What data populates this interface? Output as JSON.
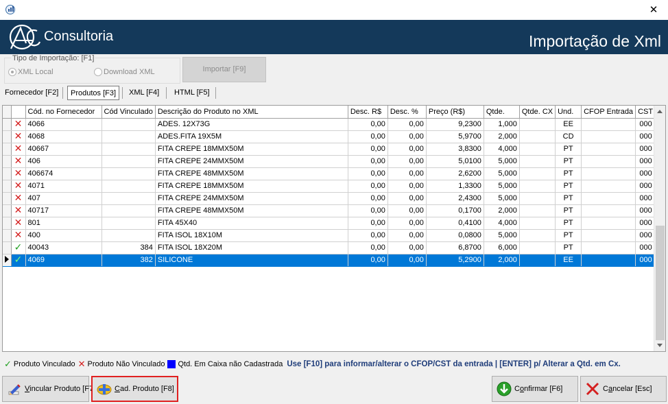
{
  "window": {
    "close_glyph": "✕"
  },
  "banner": {
    "brand": "Consultoria",
    "title": "Importação de Xml",
    "logo_letters": "AC"
  },
  "import_type": {
    "label": "Tipo de Importação: [F1]",
    "options": [
      {
        "label": "XML Local",
        "selected": true
      },
      {
        "label": "Download XML",
        "selected": false
      }
    ],
    "import_button": "Importar [F9]"
  },
  "tabs": [
    {
      "label": "Fornecedor [F2]",
      "active": false
    },
    {
      "label": "Produtos [F3]",
      "active": true
    },
    {
      "label": "XML [F4]",
      "active": false
    },
    {
      "label": "HTML [F5]",
      "active": false
    }
  ],
  "grid": {
    "columns": [
      "Cód. no Fornecedor",
      "Cód Vinculado",
      "Descrição do Produto no XML",
      "Desc. R$",
      "Desc. %",
      "Preço (R$)",
      "Qtde.",
      "Qtde. CX",
      "Und.",
      "CFOP Entrada",
      "CST"
    ],
    "rows": [
      {
        "status": "x",
        "cod": "4066",
        "vinc": "",
        "desc": "ADES. 12X73G",
        "desc_rs": "0,00",
        "desc_pct": "0,00",
        "preco": "9,2300",
        "qtde": "1,000",
        "qtde_cx": "",
        "und": "EE",
        "cfop": "",
        "cst": "000"
      },
      {
        "status": "x",
        "cod": "4068",
        "vinc": "",
        "desc": "ADES.FITA 19X5M",
        "desc_rs": "0,00",
        "desc_pct": "0,00",
        "preco": "5,9700",
        "qtde": "2,000",
        "qtde_cx": "",
        "und": "CD",
        "cfop": "",
        "cst": "000"
      },
      {
        "status": "x",
        "cod": "40667",
        "vinc": "",
        "desc": "FITA CREPE 18MMX50M",
        "desc_rs": "0,00",
        "desc_pct": "0,00",
        "preco": "3,8300",
        "qtde": "4,000",
        "qtde_cx": "",
        "und": "PT",
        "cfop": "",
        "cst": "000"
      },
      {
        "status": "x",
        "cod": "406",
        "vinc": "",
        "desc": "FITA CREPE 24MMX50M",
        "desc_rs": "0,00",
        "desc_pct": "0,00",
        "preco": "5,0100",
        "qtde": "5,000",
        "qtde_cx": "",
        "und": "PT",
        "cfop": "",
        "cst": "000"
      },
      {
        "status": "x",
        "cod": "406674",
        "vinc": "",
        "desc": "FITA CREPE 48MMX50M",
        "desc_rs": "0,00",
        "desc_pct": "0,00",
        "preco": "2,6200",
        "qtde": "5,000",
        "qtde_cx": "",
        "und": "PT",
        "cfop": "",
        "cst": "000"
      },
      {
        "status": "x",
        "cod": "4071",
        "vinc": "",
        "desc": "FITA CREPE 18MMX50M",
        "desc_rs": "0,00",
        "desc_pct": "0,00",
        "preco": "1,3300",
        "qtde": "5,000",
        "qtde_cx": "",
        "und": "PT",
        "cfop": "",
        "cst": "000"
      },
      {
        "status": "x",
        "cod": "407",
        "vinc": "",
        "desc": "FITA CREPE 24MMX50M",
        "desc_rs": "0,00",
        "desc_pct": "0,00",
        "preco": "2,4300",
        "qtde": "5,000",
        "qtde_cx": "",
        "und": "PT",
        "cfop": "",
        "cst": "000"
      },
      {
        "status": "x",
        "cod": "40717",
        "vinc": "",
        "desc": "FITA CREPE 48MMX50M",
        "desc_rs": "0,00",
        "desc_pct": "0,00",
        "preco": "0,1700",
        "qtde": "2,000",
        "qtde_cx": "",
        "und": "PT",
        "cfop": "",
        "cst": "000"
      },
      {
        "status": "x",
        "cod": "801",
        "vinc": "",
        "desc": "FITA 45X40",
        "desc_rs": "0,00",
        "desc_pct": "0,00",
        "preco": "0,4100",
        "qtde": "4,000",
        "qtde_cx": "",
        "und": "PT",
        "cfop": "",
        "cst": "000"
      },
      {
        "status": "x",
        "cod": "400",
        "vinc": "",
        "desc": "FITA ISOL 18X10M",
        "desc_rs": "0,00",
        "desc_pct": "0,00",
        "preco": "0,0800",
        "qtde": "5,000",
        "qtde_cx": "",
        "und": "PT",
        "cfop": "",
        "cst": "000"
      },
      {
        "status": "ok",
        "cod": "40043",
        "vinc": "384",
        "desc": "FITA ISOL 18X20M",
        "desc_rs": "0,00",
        "desc_pct": "0,00",
        "preco": "6,8700",
        "qtde": "6,000",
        "qtde_cx": "",
        "und": "PT",
        "cfop": "",
        "cst": "000"
      },
      {
        "status": "ok",
        "cod": "4069",
        "vinc": "382",
        "desc": "SILICONE",
        "desc_rs": "0,00",
        "desc_pct": "0,00",
        "preco": "5,2900",
        "qtde": "2,000",
        "qtde_cx": "",
        "und": "EE",
        "cfop": "",
        "cst": "000",
        "selected": true
      }
    ]
  },
  "legend": {
    "linked": "Produto Vinculado",
    "not_linked": "Produto Não Vinculado",
    "box_missing": "Qtd. Em Caixa não Cadastrada",
    "hint": "Use [F10] para informar/alterar o CFOP/CST da entrada | [ENTER] p/ Alterar a Qtd. em Cx."
  },
  "buttons": {
    "link": "Vincular Produto [F7]",
    "register": "Cad. Produto [F8]",
    "confirm": "Confirmar [F6]",
    "cancel": "Cancelar [Esc]"
  },
  "colors": {
    "banner": "#14395a",
    "selection": "#0078d7",
    "error": "#d42020",
    "ok": "#1e9e1e",
    "focus_border": "#e02020"
  }
}
